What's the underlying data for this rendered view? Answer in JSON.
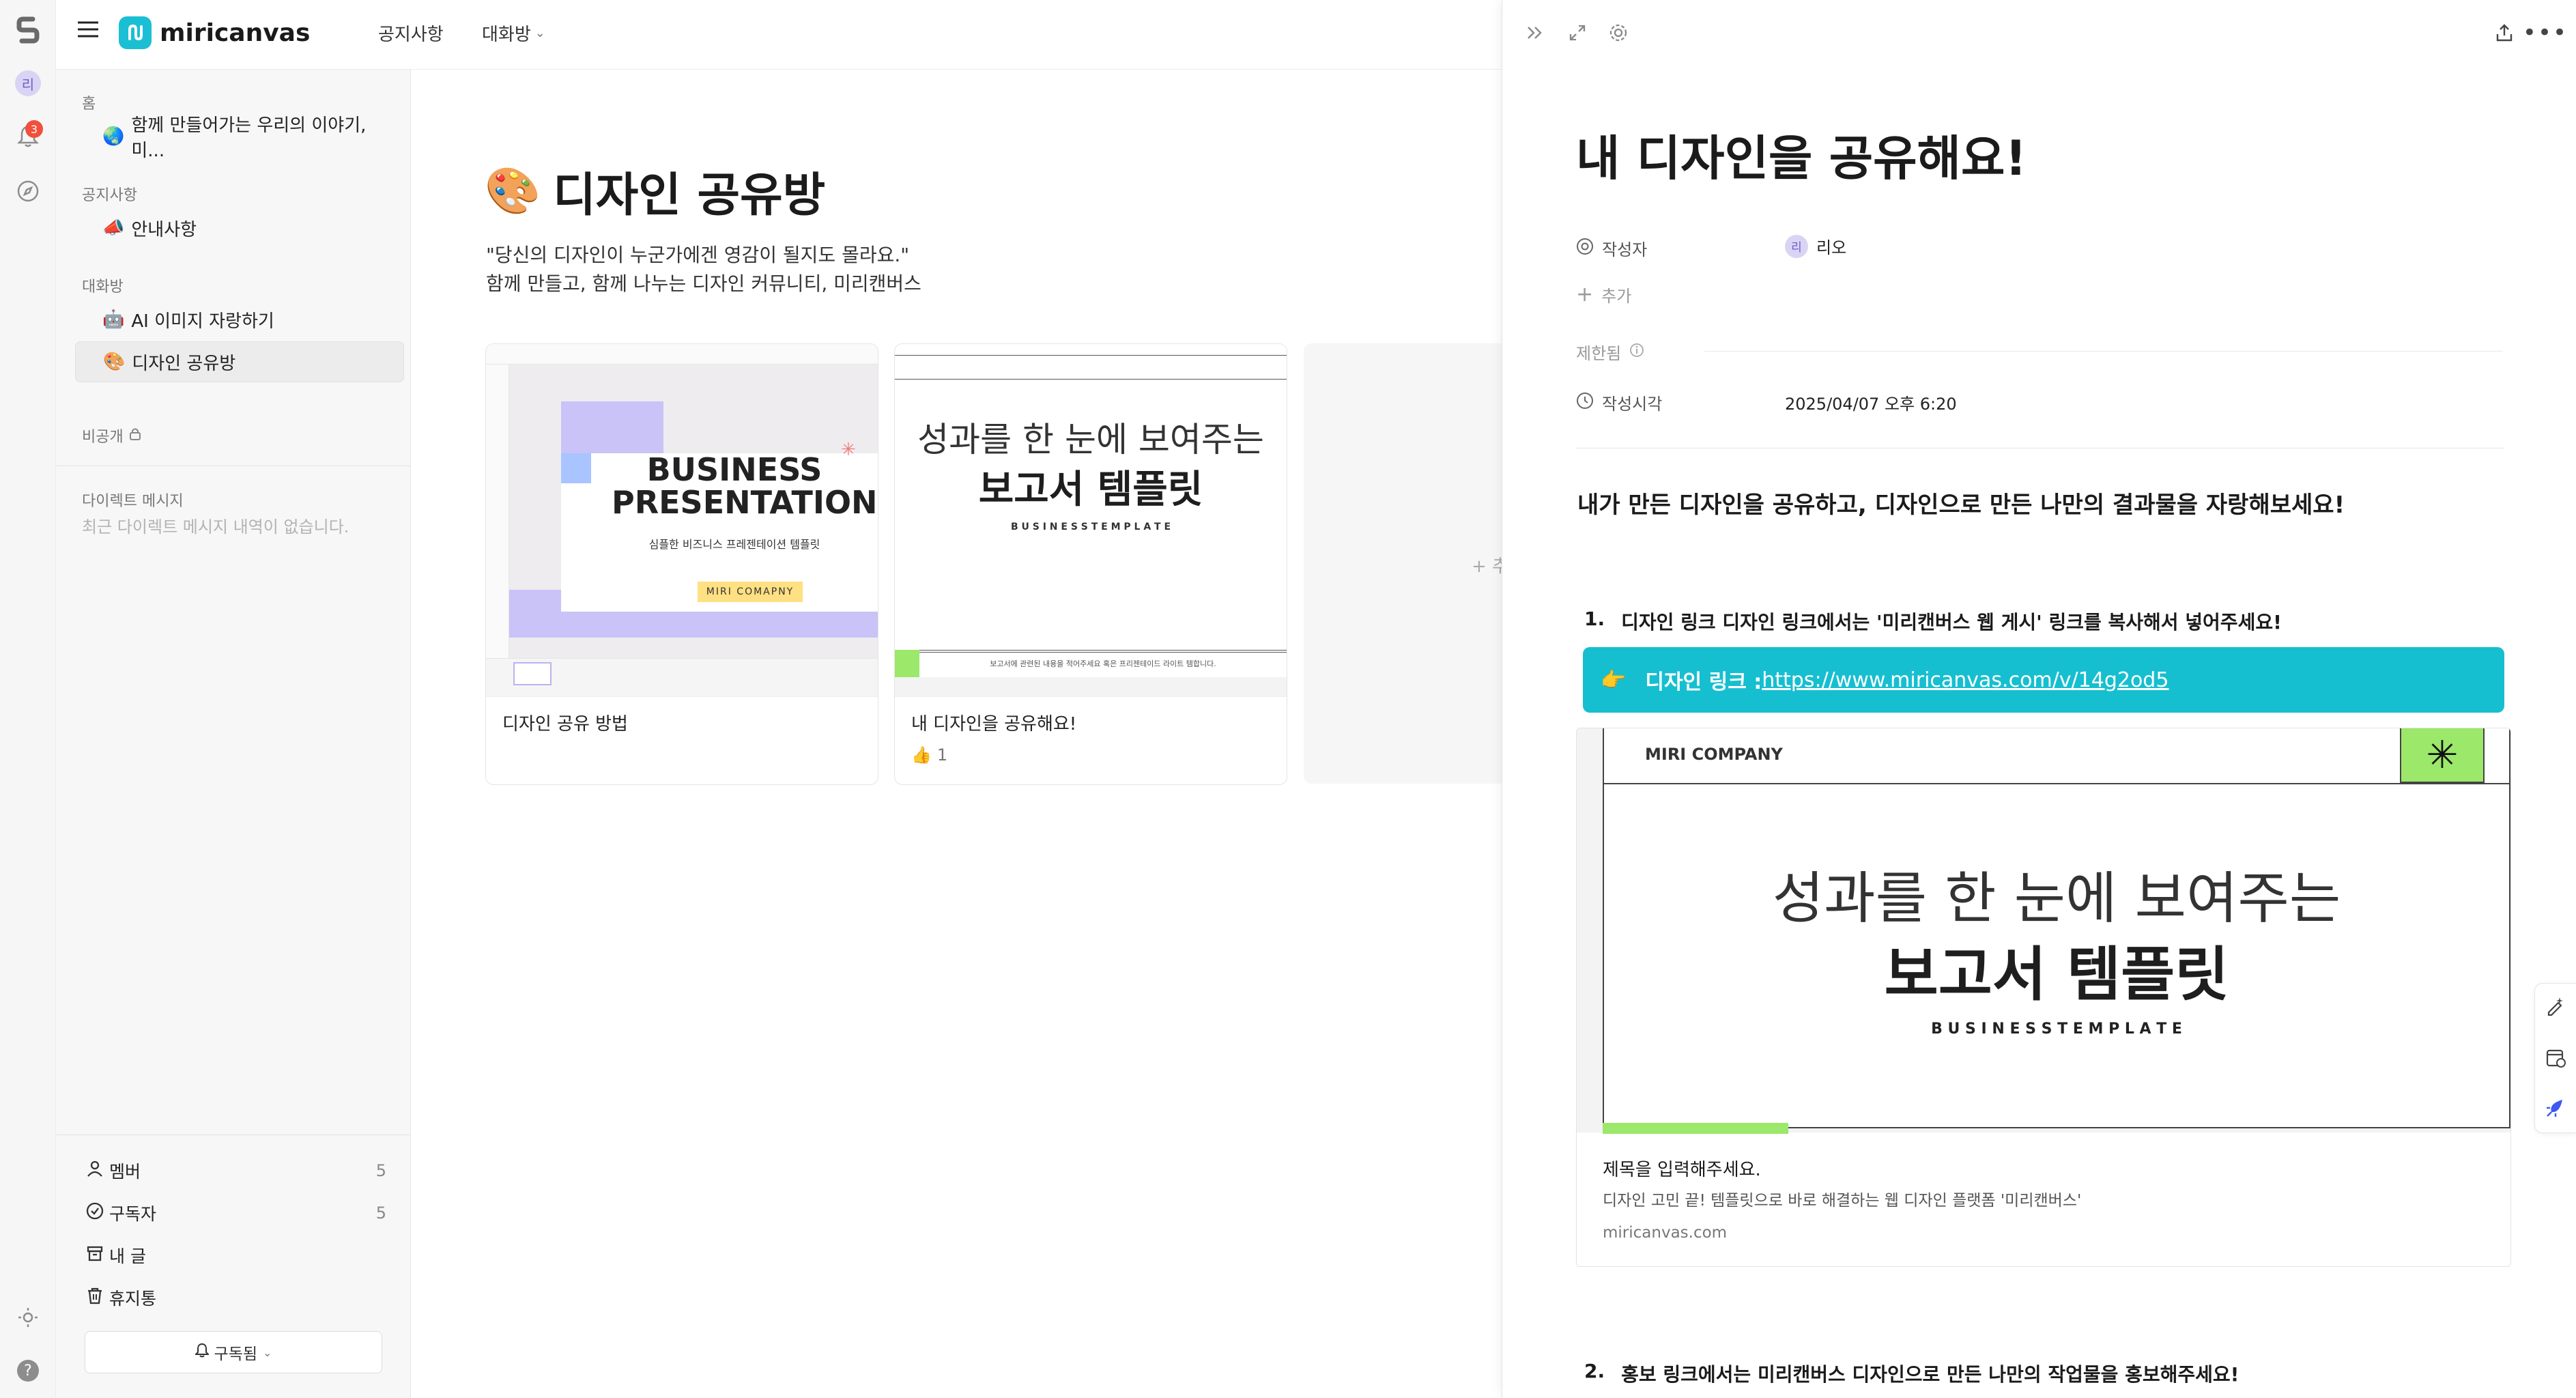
{
  "rail": {
    "avatar": "리",
    "notif_count": "3"
  },
  "app": {
    "name": "miricanvas"
  },
  "topnav": {
    "notice": "공지사항",
    "chat": "대화방"
  },
  "sidebar": {
    "home_label": "홈",
    "home_item": "함께 만들어가는 우리의 이야기, 미...",
    "notice_label": "공지사항",
    "notice_item": "안내사항",
    "chat_label": "대화방",
    "chat_item1": "AI 이미지 자랑하기",
    "chat_item2": "디자인 공유방",
    "private_label": "비공개",
    "dm_label": "다이렉트 메시지",
    "dm_empty": "최근 다이렉트 메시지 내역이 없습니다.",
    "footer": {
      "members": "멤버",
      "members_count": "5",
      "subscribers": "구독자",
      "subscribers_count": "5",
      "my_posts": "내 글",
      "trash": "휴지통",
      "subscribed_button": "구독됨"
    }
  },
  "main": {
    "title_emoji": "🎨",
    "title": "디자인 공유방",
    "desc1": "\"당신의 디자인이 누군가에겐 영감이 될지도 몰라요.\"",
    "desc2": "함께 만들고, 함께 나누는 디자인 커뮤니티, 미리캔버스",
    "cards": [
      {
        "title": "디자인 공유 방법",
        "thumb_l1": "BUSINESS",
        "thumb_l2": "PRESENTATION",
        "thumb_sub": "심플한 비즈니스 프레젠테이션 템플릿",
        "thumb_badge": "MIRI COMAPNY"
      },
      {
        "title": "내 디자인을 공유해요!",
        "likes": "1",
        "thumb_l1": "성과를 한 눈에 보여주는",
        "thumb_l2": "보고서 템플릿",
        "thumb_sub": "B U S I N E S S   T E M P L A T E",
        "thumb_footer": "보고서에 관련된 내용을 적어주세요 혹은 프리젠테이드 라이트 템합니다."
      }
    ],
    "add_card_label": "+ 추"
  },
  "panel": {
    "title": "내 디자인을 공유해요!",
    "author_label": "작성자",
    "author_avatar": "리",
    "author_name": "리오",
    "add_label": "추가",
    "restricted_label": "제한됨",
    "created_label": "작성시각",
    "created_value": "2025/04/07 오후 6:20",
    "intro": "내가 만든 디자인을 공유하고, 디자인으로 만든 나만의 결과물을 자랑해보세요!",
    "step1_num": "1.",
    "step1_text": "디자인 링크 디자인 링크에서는 '미리캔버스 웹 게시' 링크를 복사해서 넣어주세요!",
    "callout_emoji": "👉",
    "callout_label": "디자인 링크 : ",
    "callout_link": "https://www.miricanvas.com/v/14g2od5",
    "preview": {
      "company": "MIRI COMPANY",
      "headline": "성과를 한 눈에 보여주는",
      "headline_bold": "보고서 템플릿",
      "sub": "B U S I N E S S   T E M P L A T E",
      "title": "제목을 입력해주세요.",
      "desc": "디자인 고민 끝! 템플릿으로 바로 해결하는 웹 디자인 플랫폼 '미리캔버스'",
      "domain": "miricanvas.com"
    },
    "step2_num": "2.",
    "step2_text": "홍보 링크에서는 미리캔버스 디자인으로 만든 나만의 작업물을 홍보해주세요!"
  },
  "colors": {
    "callout_bg": "#16bfd0",
    "accent_green": "#9be86a",
    "lavender": "#c9c3f7"
  }
}
